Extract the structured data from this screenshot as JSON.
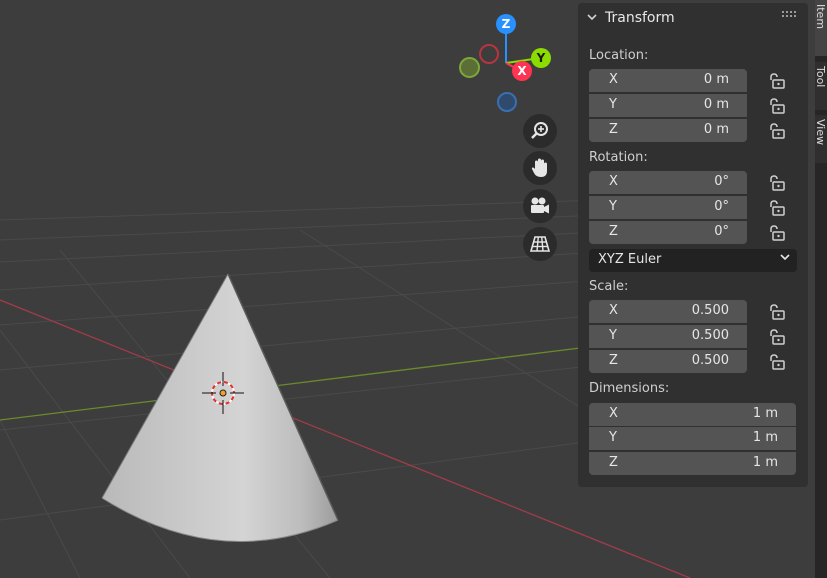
{
  "viewport": {
    "gizmo": {
      "z": "Z",
      "y": "Y",
      "x": "X"
    }
  },
  "panel": {
    "title": "Transform",
    "location": {
      "label": "Location:",
      "rows": [
        {
          "axis": "X",
          "value": "0 m"
        },
        {
          "axis": "Y",
          "value": "0 m"
        },
        {
          "axis": "Z",
          "value": "0 m"
        }
      ]
    },
    "rotation": {
      "label": "Rotation:",
      "rows": [
        {
          "axis": "X",
          "value": "0°"
        },
        {
          "axis": "Y",
          "value": "0°"
        },
        {
          "axis": "Z",
          "value": "0°"
        }
      ],
      "mode": "XYZ Euler"
    },
    "scale": {
      "label": "Scale:",
      "rows": [
        {
          "axis": "X",
          "value": "0.500"
        },
        {
          "axis": "Y",
          "value": "0.500"
        },
        {
          "axis": "Z",
          "value": "0.500"
        }
      ]
    },
    "dimensions": {
      "label": "Dimensions:",
      "rows": [
        {
          "axis": "X",
          "value": "1 m"
        },
        {
          "axis": "Y",
          "value": "1 m"
        },
        {
          "axis": "Z",
          "value": "1 m"
        }
      ]
    }
  },
  "sidetabs": [
    "Item",
    "Tool",
    "View"
  ],
  "colors": {
    "axis_x": "#ff3352",
    "axis_y": "#8bdc00",
    "axis_z": "#2890ff",
    "panel_bg": "#303030",
    "field_bg": "#545454"
  }
}
